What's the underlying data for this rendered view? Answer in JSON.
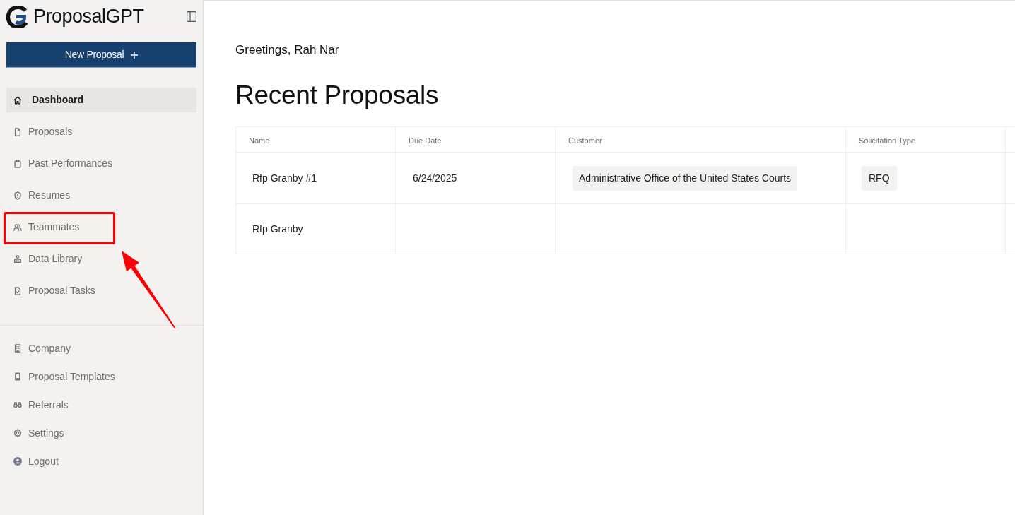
{
  "sidebar": {
    "logo": {
      "text": "ProposalGPT"
    },
    "new_button": {
      "label": "New Proposal"
    },
    "nav_items": [
      {
        "label": "Dashboard",
        "selected": true,
        "highlighted": false
      },
      {
        "label": "Proposals",
        "selected": false,
        "highlighted": false
      },
      {
        "label": "Past Performances",
        "selected": false,
        "highlighted": false
      },
      {
        "label": "Resumes",
        "selected": false,
        "highlighted": false
      },
      {
        "label": "Teammates",
        "selected": false,
        "highlighted": true
      },
      {
        "label": "Data Library",
        "selected": false,
        "highlighted": false
      },
      {
        "label": "Proposal Tasks",
        "selected": false,
        "highlighted": false
      }
    ],
    "bottom_items": [
      {
        "label": "Company",
        "selected": false
      },
      {
        "label": "Proposal Templates",
        "selected": false
      },
      {
        "label": "Referrals",
        "selected": false
      },
      {
        "label": "Settings",
        "selected": false
      },
      {
        "label": "Logout",
        "selected": false
      }
    ]
  },
  "main": {
    "greeting": "Greetings, Rah Nar",
    "title": "Recent Proposals",
    "table": {
      "columns": [
        "Name",
        "Due Date",
        "Customer",
        "Solicitation Type"
      ],
      "rows": [
        {
          "name": "Rfp Granby #1",
          "due_date": "6/24/2025",
          "customer": "Administrative Office of the United States Courts",
          "solicitation_type": "RFQ"
        },
        {
          "name": "Rfp Granby"
        }
      ]
    }
  }
}
